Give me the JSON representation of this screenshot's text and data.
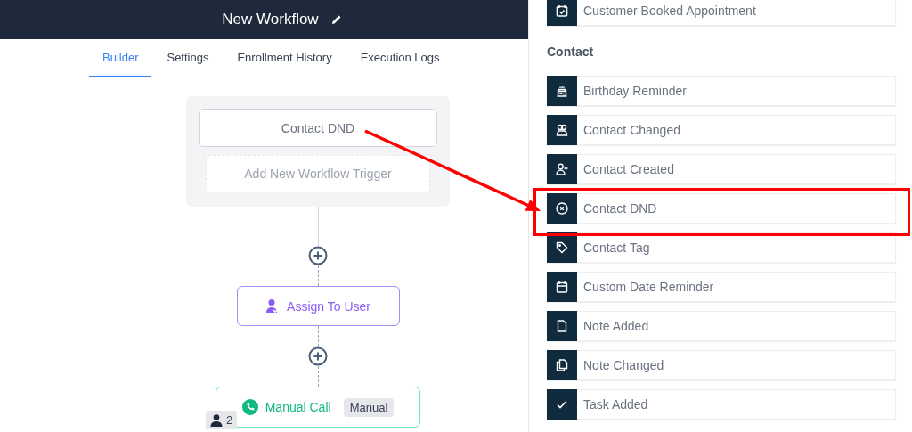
{
  "header": {
    "title": "New Workflow"
  },
  "tabs": [
    {
      "label": "Builder",
      "selected": true
    },
    {
      "label": "Settings",
      "selected": false
    },
    {
      "label": "Enrollment History",
      "selected": false
    },
    {
      "label": "Execution Logs",
      "selected": false
    }
  ],
  "canvas": {
    "triggers": [
      {
        "label": "Contact DND",
        "kind": "trigger"
      },
      {
        "label": "Add New Workflow Trigger",
        "kind": "add"
      }
    ],
    "steps": [
      {
        "label": "Assign To User",
        "kind": "assign"
      },
      {
        "label": "Manual Call",
        "kind": "call",
        "tag": "Manual",
        "contacts": "2"
      }
    ]
  },
  "panel": {
    "top_items": [
      {
        "label": "Customer Booked Appointment"
      }
    ],
    "section": "Contact",
    "items": [
      {
        "label": "Birthday Reminder"
      },
      {
        "label": "Contact Changed"
      },
      {
        "label": "Contact Created"
      },
      {
        "label": "Contact DND"
      },
      {
        "label": "Contact Tag"
      },
      {
        "label": "Custom Date Reminder"
      },
      {
        "label": "Note Added"
      },
      {
        "label": "Note Changed"
      },
      {
        "label": "Task Added"
      }
    ]
  }
}
